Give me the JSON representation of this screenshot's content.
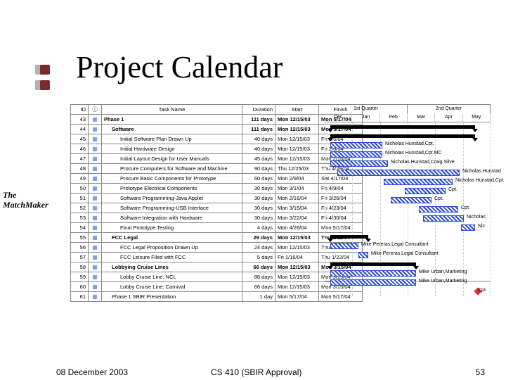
{
  "title": "Project Calendar",
  "side_label_1": "The",
  "side_label_2": "MatchMaker",
  "footer": {
    "left": "08 December 2003",
    "center": "CS 410 (SBIR Approval)",
    "right": "53"
  },
  "timeline": {
    "quarters": [
      "1st Quarter",
      "2nd Quarter"
    ],
    "months": [
      "Dec",
      "Jan",
      "Feb",
      "Mar",
      "Apr",
      "May"
    ]
  },
  "columns": {
    "id": "ID",
    "info": "ⓘ",
    "name": "Task Name",
    "duration": "Duration",
    "start": "Start",
    "finish": "Finish"
  },
  "chart_data": {
    "type": "gantt",
    "x_start": "2003-12-01",
    "x_end": "2004-06-01",
    "tasks": [
      {
        "id": "43",
        "name": "Phase 1",
        "duration": "111 days",
        "start": "Mon 12/15/03",
        "finish": "Mon 5/17/04",
        "summary": true,
        "indent": 0,
        "bar_start": 8,
        "bar_end": 214,
        "res": ""
      },
      {
        "id": "44",
        "name": "Software",
        "duration": "111 days",
        "start": "Mon 12/15/03",
        "finish": "Mon 5/17/04",
        "summary": true,
        "indent": 1,
        "bar_start": 8,
        "bar_end": 214,
        "res": ""
      },
      {
        "id": "45",
        "name": "Initial Software Plan Drawn Up",
        "duration": "40 days",
        "start": "Mon 12/15/03",
        "finish": "Fri 2/6/04",
        "summary": false,
        "indent": 2,
        "bar_start": 8,
        "bar_end": 82,
        "res": "Nicholas Hunstad,Cpt."
      },
      {
        "id": "46",
        "name": "Initial Hardware Design",
        "duration": "40 days",
        "start": "Mon 12/15/03",
        "finish": "Fri 2/6/04",
        "summary": false,
        "indent": 2,
        "bar_start": 8,
        "bar_end": 82,
        "res": "Nicholas Hunstad,Cpt.MC"
      },
      {
        "id": "47",
        "name": "Initial Layout Design for User Manuals",
        "duration": "45 days",
        "start": "Mon 12/15/03",
        "finish": "Mon 2/16/04",
        "summary": false,
        "indent": 2,
        "bar_start": 8,
        "bar_end": 90,
        "res": "Nicholas Hunstad,Craig Silve"
      },
      {
        "id": "48",
        "name": "Procure Computers for Software and Machine",
        "duration": "90 days",
        "start": "Thu 12/25/03",
        "finish": "Thu 4/29/04",
        "summary": false,
        "indent": 2,
        "bar_start": 18,
        "bar_end": 192,
        "res": "Nicholas Hunstad"
      },
      {
        "id": "49",
        "name": "Procure Basic Components for Prototype",
        "duration": "60 days",
        "start": "Mon 2/9/04",
        "finish": "Sat 4/17/04",
        "summary": false,
        "indent": 2,
        "bar_start": 84,
        "bar_end": 182,
        "res": "Nicholas Hunstad,Cpt."
      },
      {
        "id": "50",
        "name": "Prototype Electrical Components",
        "duration": "30 days",
        "start": "Mon 3/1/04",
        "finish": "Fri 4/9/04",
        "summary": false,
        "indent": 2,
        "bar_start": 114,
        "bar_end": 172,
        "res": "Cpt."
      },
      {
        "id": "51",
        "name": "Software Programming-Java Applet",
        "duration": "30 days",
        "start": "Mon 2/16/04",
        "finish": "Fri 3/26/04",
        "summary": false,
        "indent": 2,
        "bar_start": 94,
        "bar_end": 152,
        "res": "Cpt."
      },
      {
        "id": "52",
        "name": "Software Programming-USB Interface",
        "duration": "30 days",
        "start": "Mon 3/15/04",
        "finish": "Fri 4/23/04",
        "summary": false,
        "indent": 2,
        "bar_start": 134,
        "bar_end": 190,
        "res": "Cpt."
      },
      {
        "id": "53",
        "name": "Software Integration with Hardware",
        "duration": "30 days",
        "start": "Mon 3/22/04",
        "finish": "Fri 4/30/04",
        "summary": false,
        "indent": 2,
        "bar_start": 140,
        "bar_end": 198,
        "res": "Nicholas"
      },
      {
        "id": "54",
        "name": "Final Prototype Testing",
        "duration": "4 days",
        "start": "Mon 4/26/04",
        "finish": "Mon 5/17/04",
        "summary": false,
        "indent": 2,
        "bar_start": 194,
        "bar_end": 214,
        "res": "Nic"
      },
      {
        "id": "55",
        "name": "FCC Legal",
        "duration": "29 days",
        "start": "Mon 12/15/03",
        "finish": "Thu 1/22/04",
        "summary": true,
        "indent": 1,
        "bar_start": 8,
        "bar_end": 62,
        "res": ""
      },
      {
        "id": "56",
        "name": "FCC Legal Proposition Drawn Up",
        "duration": "24 days",
        "start": "Mon 12/15/03",
        "finish": "Thu 1/15/04",
        "summary": false,
        "indent": 2,
        "bar_start": 8,
        "bar_end": 48,
        "res": "Mike Pereras,Legal Consultant"
      },
      {
        "id": "57",
        "name": "FCC Leisure Filed with FCC",
        "duration": "5 days",
        "start": "Fri 1/16/04",
        "finish": "Thu 1/22/04",
        "summary": false,
        "indent": 2,
        "bar_start": 48,
        "bar_end": 62,
        "res": "Mike Pereras,Legal Consultant"
      },
      {
        "id": "58",
        "name": "Lobbying Cruise Lines",
        "duration": "66 days",
        "start": "Mon 12/15/03",
        "finish": "Mon 3/15/04",
        "summary": true,
        "indent": 1,
        "bar_start": 8,
        "bar_end": 130,
        "res": ""
      },
      {
        "id": "59",
        "name": "Lobby Cruise Line: NCL",
        "duration": "88 days",
        "start": "Mon 12/15/03",
        "finish": "Mon 3/15/04",
        "summary": false,
        "indent": 2,
        "bar_start": 8,
        "bar_end": 130,
        "res": "Mike Urban,Marketing"
      },
      {
        "id": "60",
        "name": "Lobby Cruise Line: Carnival",
        "duration": "66 days",
        "start": "Mon 12/15/03",
        "finish": "Mon 3/15/04",
        "summary": false,
        "indent": 2,
        "bar_start": 8,
        "bar_end": 130,
        "res": "Mike Urban,Marketing"
      },
      {
        "id": "61",
        "name": "Phase 1 SBIR Presentation",
        "duration": "1 day",
        "start": "Mon 5/17/04",
        "finish": "Mon 5/17/04",
        "summary": false,
        "indent": 1,
        "bar_start": 214,
        "bar_end": 214,
        "res": "Cpt",
        "milestone": true
      }
    ]
  }
}
